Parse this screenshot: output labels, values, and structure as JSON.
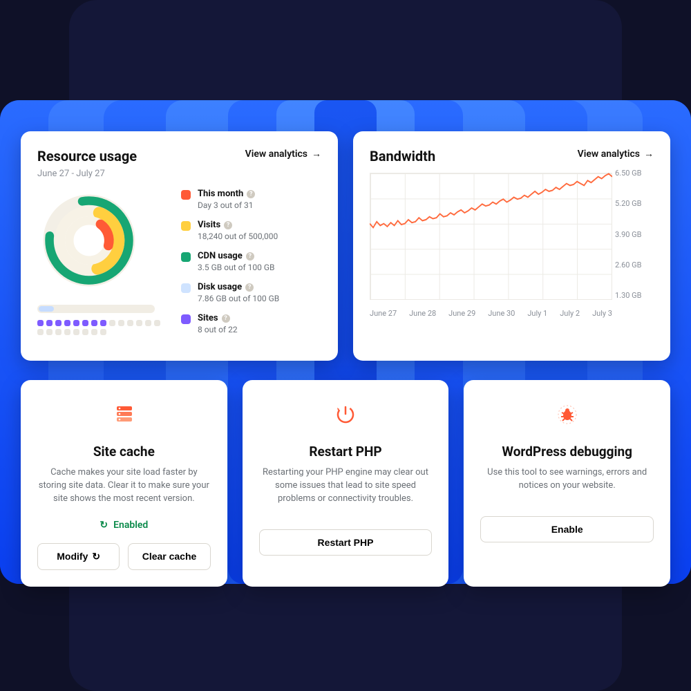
{
  "colors": {
    "this_month": "#ff5a36",
    "visits": "#ffcf3f",
    "cdn": "#17a673",
    "disk": "#cfe3ff",
    "sites": "#7e5bff",
    "chart_line": "#ff6a3d"
  },
  "resource_card": {
    "title": "Resource usage",
    "date_range": "June 27 - July 27",
    "view_link": "View analytics",
    "legend": [
      {
        "key": "this_month",
        "label": "This month",
        "desc": "Day 3 out of 31"
      },
      {
        "key": "visits",
        "label": "Visits",
        "desc": "18,240 out of 500,000"
      },
      {
        "key": "cdn",
        "label": "CDN usage",
        "desc": "3.5 GB out of 100 GB"
      },
      {
        "key": "disk",
        "label": "Disk usage",
        "desc": "7.86 GB out of 100 GB"
      },
      {
        "key": "sites",
        "label": "Sites",
        "desc": "8 out of 22"
      }
    ],
    "sites_filled": 8,
    "sites_total": 22
  },
  "bandwidth_card": {
    "title": "Bandwidth",
    "view_link": "View analytics"
  },
  "chart_data": {
    "type": "line",
    "title": "Bandwidth",
    "xlabel": "",
    "ylabel": "",
    "ylim": [
      0,
      6.5
    ],
    "y_ticks": [
      "6.50 GB",
      "5.20 GB",
      "3.90 GB",
      "2.60 GB",
      "1.30 GB"
    ],
    "x_ticks": [
      "June 27",
      "June 28",
      "June 29",
      "June 30",
      "July 1",
      "July 2",
      "July 3"
    ],
    "x": [
      0,
      1,
      2,
      3,
      4,
      5,
      6,
      7,
      8,
      9,
      10,
      11,
      12,
      13,
      14,
      15,
      16,
      17,
      18,
      19,
      20,
      21,
      22,
      23,
      24,
      25,
      26,
      27,
      28,
      29,
      30,
      31,
      32,
      33,
      34,
      35,
      36,
      37,
      38,
      39,
      40,
      41,
      42,
      43,
      44,
      45,
      46,
      47,
      48,
      49,
      50,
      51,
      52,
      53,
      54,
      55,
      56,
      57,
      58,
      59,
      60,
      61,
      62,
      63,
      64,
      65,
      66,
      67,
      68,
      69
    ],
    "values": [
      3.9,
      3.7,
      4.0,
      3.8,
      3.9,
      3.75,
      3.95,
      3.8,
      4.05,
      3.85,
      3.9,
      4.1,
      3.95,
      4.0,
      4.2,
      4.05,
      4.1,
      4.25,
      4.15,
      4.2,
      4.4,
      4.25,
      4.3,
      4.45,
      4.35,
      4.5,
      4.6,
      4.45,
      4.55,
      4.7,
      4.6,
      4.75,
      4.9,
      4.8,
      4.85,
      5.0,
      4.9,
      5.05,
      5.15,
      5.0,
      5.1,
      5.25,
      5.15,
      5.2,
      5.35,
      5.25,
      5.4,
      5.55,
      5.4,
      5.5,
      5.65,
      5.55,
      5.6,
      5.75,
      5.65,
      5.8,
      5.95,
      5.85,
      5.9,
      6.05,
      5.95,
      5.85,
      6.1,
      6.0,
      6.15,
      6.3,
      6.2,
      6.35,
      6.45,
      6.3
    ]
  },
  "tool_cards": {
    "cache": {
      "title": "Site cache",
      "desc": "Cache makes your site load faster by storing site data. Clear it to make sure your site shows the most recent version.",
      "status": "Enabled",
      "modify_btn": "Modify",
      "clear_btn": "Clear cache"
    },
    "php": {
      "title": "Restart PHP",
      "desc": "Restarting your PHP engine may clear out some issues that lead to site speed problems or connectivity troubles.",
      "button": "Restart PHP"
    },
    "debug": {
      "title": "WordPress debugging",
      "desc": "Use this tool to see warnings, errors and notices on your website.",
      "button": "Enable"
    }
  }
}
